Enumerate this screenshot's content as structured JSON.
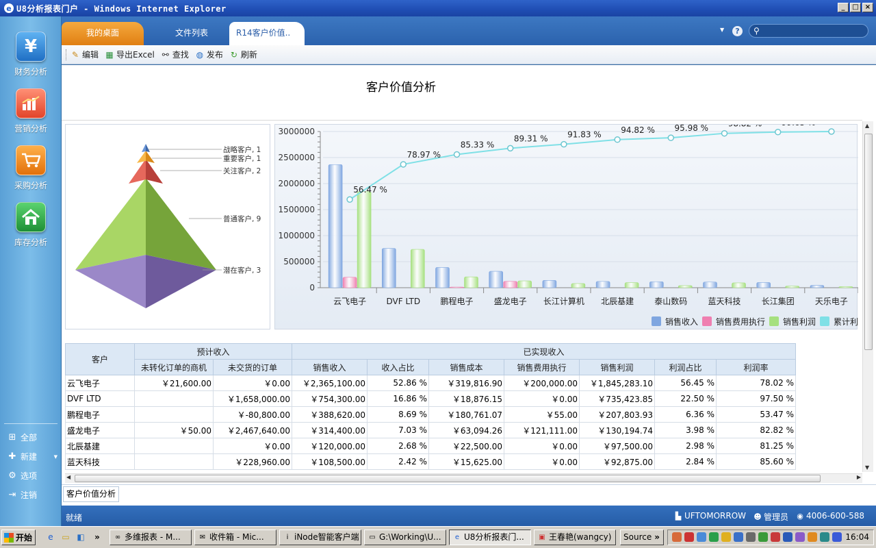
{
  "window": {
    "title": "U8分析报表门户 - Windows Internet Explorer"
  },
  "sidebar": {
    "modules": [
      {
        "label": "财务分析",
        "icon": "yen-icon",
        "color": "#2e86de"
      },
      {
        "label": "营销分析",
        "icon": "bar-chart-icon",
        "color": "#f05a3c"
      },
      {
        "label": "采购分析",
        "icon": "shopping-cart-icon",
        "color": "#f58a1f"
      },
      {
        "label": "库存分析",
        "icon": "house-icon",
        "color": "#2fa84f"
      }
    ],
    "bottom": [
      {
        "label": "全部",
        "icon": "tree-icon"
      },
      {
        "label": "新建",
        "icon": "new-icon"
      },
      {
        "label": "选项",
        "icon": "gear-icon"
      },
      {
        "label": "注销",
        "icon": "logout-icon"
      }
    ]
  },
  "tabs": [
    {
      "label": "我的桌面"
    },
    {
      "label": "文件列表"
    },
    {
      "label": "R14客户价值.."
    }
  ],
  "search": {
    "placeholder": ""
  },
  "toolbar": {
    "edit": "编辑",
    "export": "导出Excel",
    "find": "查找",
    "publish": "发布",
    "refresh": "刷新"
  },
  "report": {
    "title": "客户价值分析"
  },
  "pyramid": {
    "tiers": [
      {
        "label": "战略客户, 1",
        "color": "#4f7ec0"
      },
      {
        "label": "重要客户, 1",
        "color": "#f0a030"
      },
      {
        "label": "关注客户, 2",
        "color": "#d84f45"
      },
      {
        "label": "普通客户, 9",
        "color": "#9cc85a"
      },
      {
        "label": "潜在客户, 3",
        "color": "#8c78b8"
      }
    ]
  },
  "chart_data": {
    "type": "bar",
    "categories": [
      "云飞电子",
      "DVF LTD",
      "鹏程电子",
      "盛龙电子",
      "长江计算机",
      "北辰基建",
      "泰山数码",
      "蓝天科技",
      "长江集团",
      "天乐电子"
    ],
    "ylim": [
      0,
      3000000
    ],
    "yticks": [
      "0",
      "500000",
      "1000000",
      "1500000",
      "2000000",
      "2500000",
      "3000000"
    ],
    "series": [
      {
        "name": "销售收入",
        "color": "#7fa6e0",
        "values": [
          2365100,
          754300,
          388620,
          314400,
          140000,
          120000,
          115000,
          108500,
          100000,
          45000
        ]
      },
      {
        "name": "销售费用执行",
        "color": "#ef7fb0",
        "values": [
          200000,
          0,
          55,
          121111,
          0,
          0,
          0,
          0,
          0,
          0
        ]
      },
      {
        "name": "销售利润",
        "color": "#a6e07f",
        "values": [
          1845283,
          735424,
          207804,
          130195,
          80000,
          97500,
          40000,
          92875,
          30000,
          20000
        ]
      },
      {
        "name": "累计利",
        "color": "#7fe0e6",
        "values": [
          56.47,
          78.97,
          85.33,
          89.31,
          91.83,
          94.82,
          95.98,
          98.82,
          99.65,
          100.0
        ],
        "labels": [
          "56.47 %",
          "78.97 %",
          "85.33 %",
          "89.31 %",
          "91.83 %",
          "94.82 %",
          "95.98 %",
          "98.82 %",
          "99.65 %",
          "100.00 %"
        ]
      }
    ],
    "legend": "bottom-right",
    "grid": true
  },
  "table": {
    "col_customer": "客户",
    "group_forecast": "预计收入",
    "group_realized": "已实现收入",
    "subheaders": [
      "未转化订单的商机",
      "未交货的订单",
      "销售收入",
      "收入占比",
      "销售成本",
      "销售费用执行",
      "销售利润",
      "利润占比",
      "利润率"
    ],
    "rows": [
      [
        "云飞电子",
        "￥21,600.00",
        "￥0.00",
        "￥2,365,100.00",
        "52.86 %",
        "￥319,816.90",
        "￥200,000.00",
        "￥1,845,283.10",
        "56.45 %",
        "78.02 %"
      ],
      [
        "DVF LTD",
        "",
        "￥1,658,000.00",
        "￥754,300.00",
        "16.86 %",
        "￥18,876.15",
        "￥0.00",
        "￥735,423.85",
        "22.50 %",
        "97.50 %"
      ],
      [
        "鹏程电子",
        "",
        "￥-80,800.00",
        "￥388,620.00",
        "8.69 %",
        "￥180,761.07",
        "￥55.00",
        "￥207,803.93",
        "6.36 %",
        "53.47 %"
      ],
      [
        "盛龙电子",
        "￥50.00",
        "￥2,467,640.00",
        "￥314,400.00",
        "7.03 %",
        "￥63,094.26",
        "￥121,111.00",
        "￥130,194.74",
        "3.98 %",
        "82.82 %"
      ],
      [
        "北辰基建",
        "",
        "￥0.00",
        "￥120,000.00",
        "2.68 %",
        "￥22,500.00",
        "￥0.00",
        "￥97,500.00",
        "2.98 %",
        "81.25 %"
      ],
      [
        "蓝天科技",
        "",
        "￥228,960.00",
        "￥108,500.00",
        "2.42 %",
        "￥15,625.00",
        "￥0.00",
        "￥92,875.00",
        "2.84 %",
        "85.60 %"
      ]
    ]
  },
  "sheet_tab": "客户价值分析",
  "status": {
    "left": "就绪",
    "user1": "UFTOMORROW",
    "user2": "管理员",
    "phone": "4006-600-588"
  },
  "taskbar": {
    "start": "开始",
    "tasks": [
      "多维报表 - M...",
      "收件箱 - Mic...",
      "iNode智能客户端",
      "G:\\Working\\U...",
      "U8分析报表门...",
      "王春艳(wangcy)"
    ],
    "source": "Source",
    "clock": "16:04"
  }
}
